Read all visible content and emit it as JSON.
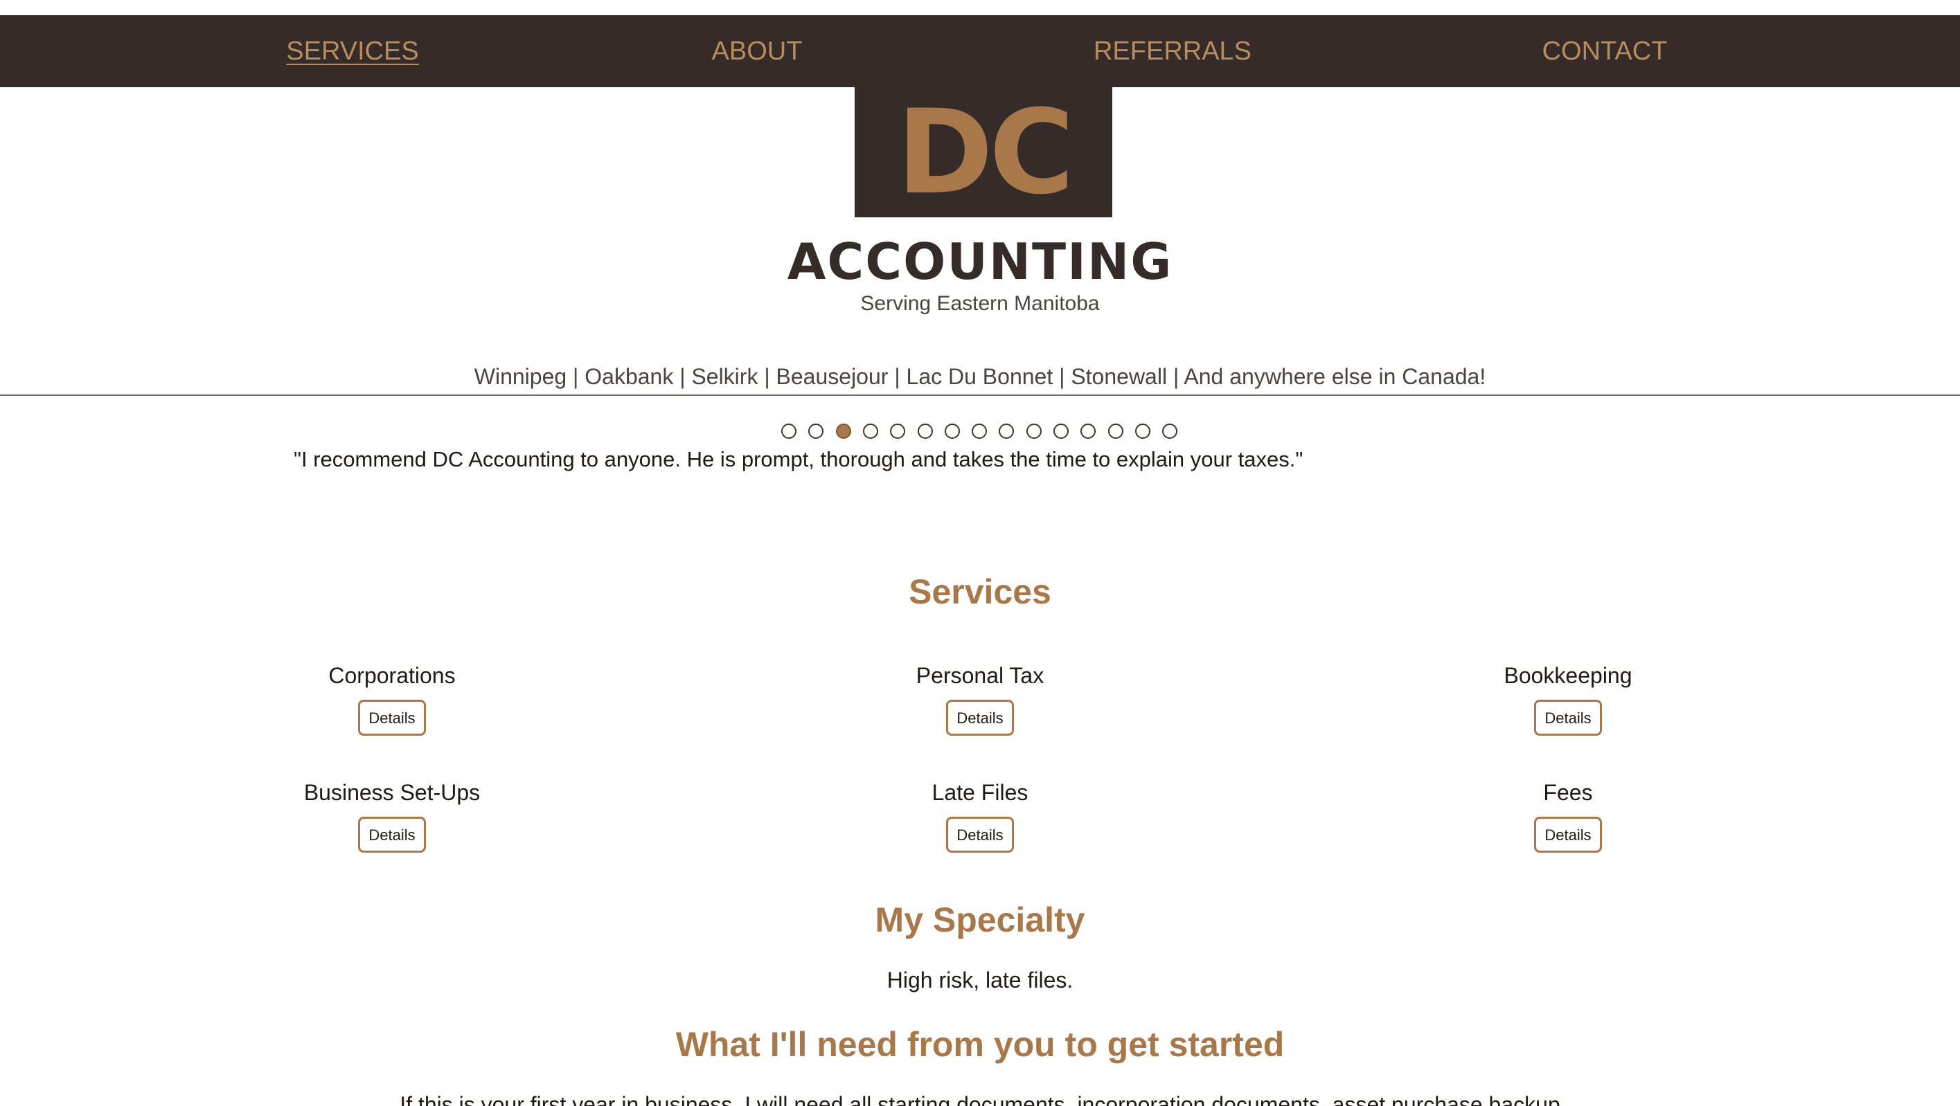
{
  "nav": {
    "items": [
      {
        "label": "SERVICES",
        "active": true
      },
      {
        "label": "ABOUT",
        "active": false
      },
      {
        "label": "REFERRALS",
        "active": false
      },
      {
        "label": "CONTACT",
        "active": false
      }
    ]
  },
  "logo": {
    "mark": "DC",
    "word": "ACCOUNTING",
    "tagline": "Serving Eastern Manitoba"
  },
  "service_areas": "Winnipeg | Oakbank | Selkirk | Beausejour | Lac Du Bonnet | Stonewall | And anywhere else in Canada!",
  "testimonials": {
    "count": 15,
    "active_index": 3,
    "quote": "\"I recommend DC Accounting to anyone. He is prompt, thorough and takes the time to explain your taxes.\""
  },
  "services": {
    "title": "Services",
    "items": [
      {
        "name": "Corporations",
        "button": "Details"
      },
      {
        "name": "Personal Tax",
        "button": "Details"
      },
      {
        "name": "Bookkeeping",
        "button": "Details"
      },
      {
        "name": "Business Set-Ups",
        "button": "Details"
      },
      {
        "name": "Late Files",
        "button": "Details"
      },
      {
        "name": "Fees",
        "button": "Details"
      }
    ]
  },
  "specialty": {
    "title": "My Specialty",
    "text": "High risk, late files."
  },
  "getting_started": {
    "title": "What I'll need from you to get started",
    "text": "If this is your first year in business, I will need all starting documents, incorporation documents, asset purchase backup"
  },
  "colors": {
    "nav_bg": "#352c29",
    "accent": "#a8774a",
    "nav_text": "#b98b5d"
  }
}
